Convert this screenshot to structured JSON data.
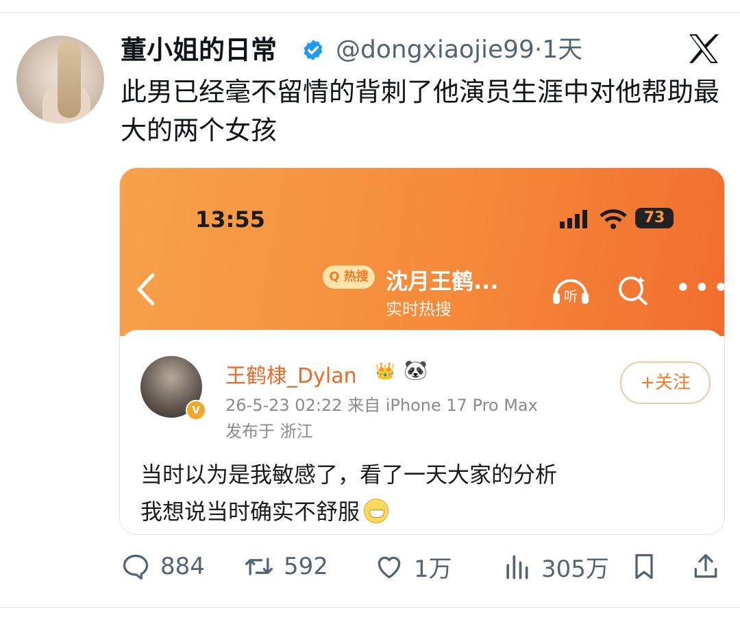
{
  "tweet": {
    "author_name": "董小姐的日常",
    "handle": "@dongxiaojie99",
    "time": "·1天",
    "text": "此男已经毫不留情的背刺了他演员生涯中对他帮助最大的两个女孩"
  },
  "screenshot": {
    "status_time": "13:55",
    "battery": "73",
    "hot_badge": "Q 热搜",
    "topic_title": "沈月王鹤...",
    "topic_subtitle": "实时热搜",
    "listen_label": "听",
    "post": {
      "username": "王鹤棣_Dylan",
      "verified_mark": "V",
      "follow_label": "+关注",
      "meta_date_device": "26-5-23 02:22  来自 iPhone 17 Pro Max",
      "meta_location": "发布于 浙江",
      "text_line1": "当时以为是我敏感了，看了一天大家的分析",
      "text_line2": "我想说当时确实不舒服"
    }
  },
  "actions": {
    "replies": "884",
    "retweets": "592",
    "likes": "1万",
    "views": "305万"
  },
  "colors": {
    "verified_blue": "#1d9bf0",
    "weibo_orange": "#f58a3a",
    "text_gray": "#536471"
  },
  "icons": [
    "verified-icon",
    "x-logo-icon",
    "signal-icon",
    "wifi-icon",
    "back-arrow-icon",
    "listen-icon",
    "search-icon",
    "more-icon",
    "panda-icon",
    "crown-icon",
    "grin-emoji-icon",
    "reply-icon",
    "retweet-icon",
    "like-icon",
    "views-icon",
    "bookmark-icon",
    "share-icon"
  ]
}
